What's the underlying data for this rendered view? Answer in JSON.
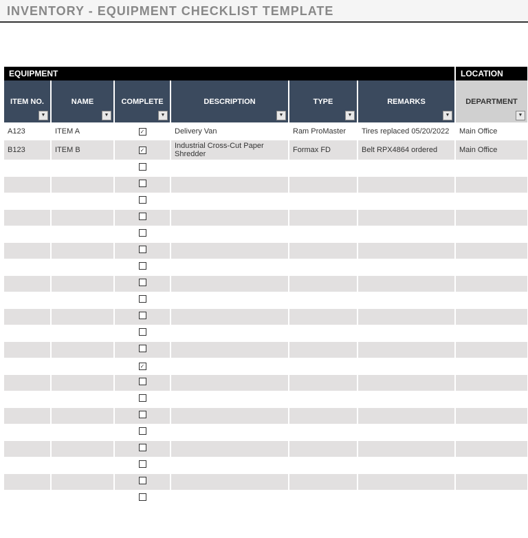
{
  "title": "INVENTORY - EQUIPMENT CHECKLIST TEMPLATE",
  "sections": {
    "equipment": "EQUIPMENT",
    "location": "LOCATION"
  },
  "headers": {
    "itemno": "ITEM NO.",
    "name": "NAME",
    "complete": "COMPLETE",
    "description": "DESCRIPTION",
    "type": "TYPE",
    "remarks": "REMARKS",
    "department": "DEPARTMENT"
  },
  "rows": [
    {
      "itemno": "A123",
      "name": "ITEM A",
      "complete": true,
      "description": "Delivery Van",
      "type": "Ram ProMaster",
      "remarks": "Tires replaced 05/20/2022",
      "department": "Main Office"
    },
    {
      "itemno": "B123",
      "name": "ITEM B",
      "complete": true,
      "description": "Industrial Cross-Cut Paper Shredder",
      "type": "Formax FD",
      "remarks": "Belt RPX4864 ordered",
      "department": "Main Office"
    },
    {
      "itemno": "",
      "name": "",
      "complete": false,
      "description": "",
      "type": "",
      "remarks": "",
      "department": ""
    },
    {
      "itemno": "",
      "name": "",
      "complete": false,
      "description": "",
      "type": "",
      "remarks": "",
      "department": ""
    },
    {
      "itemno": "",
      "name": "",
      "complete": false,
      "description": "",
      "type": "",
      "remarks": "",
      "department": ""
    },
    {
      "itemno": "",
      "name": "",
      "complete": false,
      "description": "",
      "type": "",
      "remarks": "",
      "department": ""
    },
    {
      "itemno": "",
      "name": "",
      "complete": false,
      "description": "",
      "type": "",
      "remarks": "",
      "department": ""
    },
    {
      "itemno": "",
      "name": "",
      "complete": false,
      "description": "",
      "type": "",
      "remarks": "",
      "department": ""
    },
    {
      "itemno": "",
      "name": "",
      "complete": false,
      "description": "",
      "type": "",
      "remarks": "",
      "department": ""
    },
    {
      "itemno": "",
      "name": "",
      "complete": false,
      "description": "",
      "type": "",
      "remarks": "",
      "department": ""
    },
    {
      "itemno": "",
      "name": "",
      "complete": false,
      "description": "",
      "type": "",
      "remarks": "",
      "department": ""
    },
    {
      "itemno": "",
      "name": "",
      "complete": false,
      "description": "",
      "type": "",
      "remarks": "",
      "department": ""
    },
    {
      "itemno": "",
      "name": "",
      "complete": false,
      "description": "",
      "type": "",
      "remarks": "",
      "department": ""
    },
    {
      "itemno": "",
      "name": "",
      "complete": false,
      "description": "",
      "type": "",
      "remarks": "",
      "department": ""
    },
    {
      "itemno": "",
      "name": "",
      "complete": true,
      "description": "",
      "type": "",
      "remarks": "",
      "department": ""
    },
    {
      "itemno": "",
      "name": "",
      "complete": false,
      "description": "",
      "type": "",
      "remarks": "",
      "department": ""
    },
    {
      "itemno": "",
      "name": "",
      "complete": false,
      "description": "",
      "type": "",
      "remarks": "",
      "department": ""
    },
    {
      "itemno": "",
      "name": "",
      "complete": false,
      "description": "",
      "type": "",
      "remarks": "",
      "department": ""
    },
    {
      "itemno": "",
      "name": "",
      "complete": false,
      "description": "",
      "type": "",
      "remarks": "",
      "department": ""
    },
    {
      "itemno": "",
      "name": "",
      "complete": false,
      "description": "",
      "type": "",
      "remarks": "",
      "department": ""
    },
    {
      "itemno": "",
      "name": "",
      "complete": false,
      "description": "",
      "type": "",
      "remarks": "",
      "department": ""
    },
    {
      "itemno": "",
      "name": "",
      "complete": false,
      "description": "",
      "type": "",
      "remarks": "",
      "department": ""
    },
    {
      "itemno": "",
      "name": "",
      "complete": false,
      "description": "",
      "type": "",
      "remarks": "",
      "department": ""
    }
  ]
}
